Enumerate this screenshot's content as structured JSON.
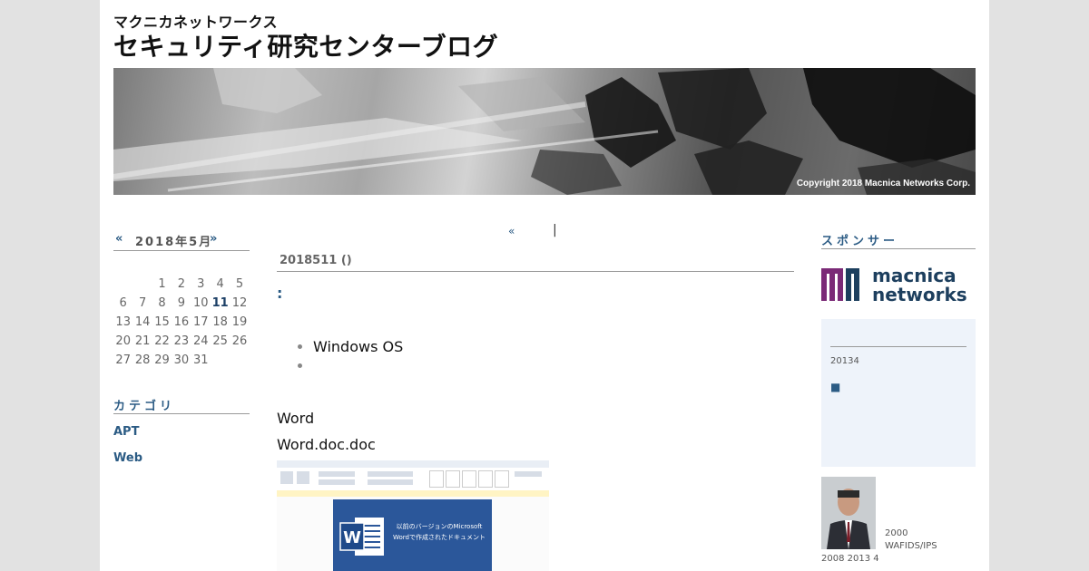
{
  "header": {
    "company": "マクニカネットワークス",
    "title": "セキュリティ研究センターブログ",
    "banner_copyright": "Copyright 2018 Macnica Networks Corp."
  },
  "calendar": {
    "prev": "«",
    "month_label": "2018年5月",
    "next": "»",
    "rows": [
      [
        "",
        "",
        "1",
        "2",
        "3",
        "4",
        "5"
      ],
      [
        "6",
        "7",
        "8",
        "9",
        "10",
        "11",
        "12"
      ],
      [
        "13",
        "14",
        "15",
        "16",
        "17",
        "18",
        "19"
      ],
      [
        "20",
        "21",
        "22",
        "23",
        "24",
        "25",
        "26"
      ],
      [
        "27",
        "28",
        "29",
        "30",
        "31",
        "",
        ""
      ]
    ],
    "highlight_day": "11"
  },
  "categories": {
    "heading": "カテゴリ",
    "items": [
      "APT",
      "Web"
    ]
  },
  "main": {
    "pager_prev": "«",
    "pager_sep": "|",
    "post_date": "2018511 ()",
    "post_title": ":",
    "bullets": [
      "Windows OS",
      ""
    ],
    "para1": "Word",
    "para2": "Word.doc.doc",
    "screenshot_caption": "以前のバージョンのMicrosoft Wordで作成されたドキュメント"
  },
  "sidebar": {
    "heading": "スポンサー",
    "logo_line1": "macnica",
    "logo_line2": "networks",
    "info_text": "20134",
    "info_mark": "■",
    "bio_line1": "2000",
    "bio_line2": "WAFIDS/IPS",
    "bio_line3": "2008  2013 4"
  },
  "colors": {
    "link": "#2b5b84",
    "logo_purple": "#7b2a77",
    "logo_navy": "#1d3f5e"
  }
}
